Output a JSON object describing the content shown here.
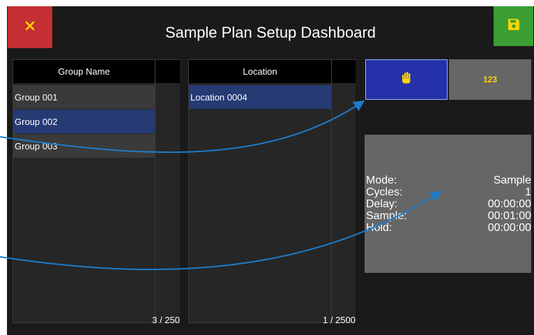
{
  "header": {
    "title": "Sample Plan Setup Dashboard",
    "close_icon": "x-icon",
    "save_icon": "floppy-disk-icon"
  },
  "group_table": {
    "header": "Group Name",
    "rows": [
      {
        "label": "Group 001",
        "selected": false
      },
      {
        "label": "Group 002",
        "selected": true
      },
      {
        "label": "Group 003",
        "selected": false
      }
    ],
    "count": "3 / 250"
  },
  "location_table": {
    "header": "Location",
    "rows": [
      {
        "label": "Location 0004",
        "selected": true
      }
    ],
    "count": "1 / 2500"
  },
  "mode_buttons": {
    "manual_icon": "hand-icon",
    "numeric_label": "123"
  },
  "info": {
    "lines": [
      {
        "label": "Mode:",
        "value": "Sample"
      },
      {
        "label": "Cycles:",
        "value": "1"
      },
      {
        "label": "Delay:",
        "value": "00:00:00"
      },
      {
        "label": "Sample:",
        "value": "00:01:00"
      },
      {
        "label": "Hold:",
        "value": "00:00:00"
      }
    ]
  },
  "colors": {
    "close": "#c62f33",
    "save": "#3a9e33",
    "selected_row": "#263a74",
    "accent_yellow": "#ffd400",
    "arrow": "#1e7bc8"
  }
}
